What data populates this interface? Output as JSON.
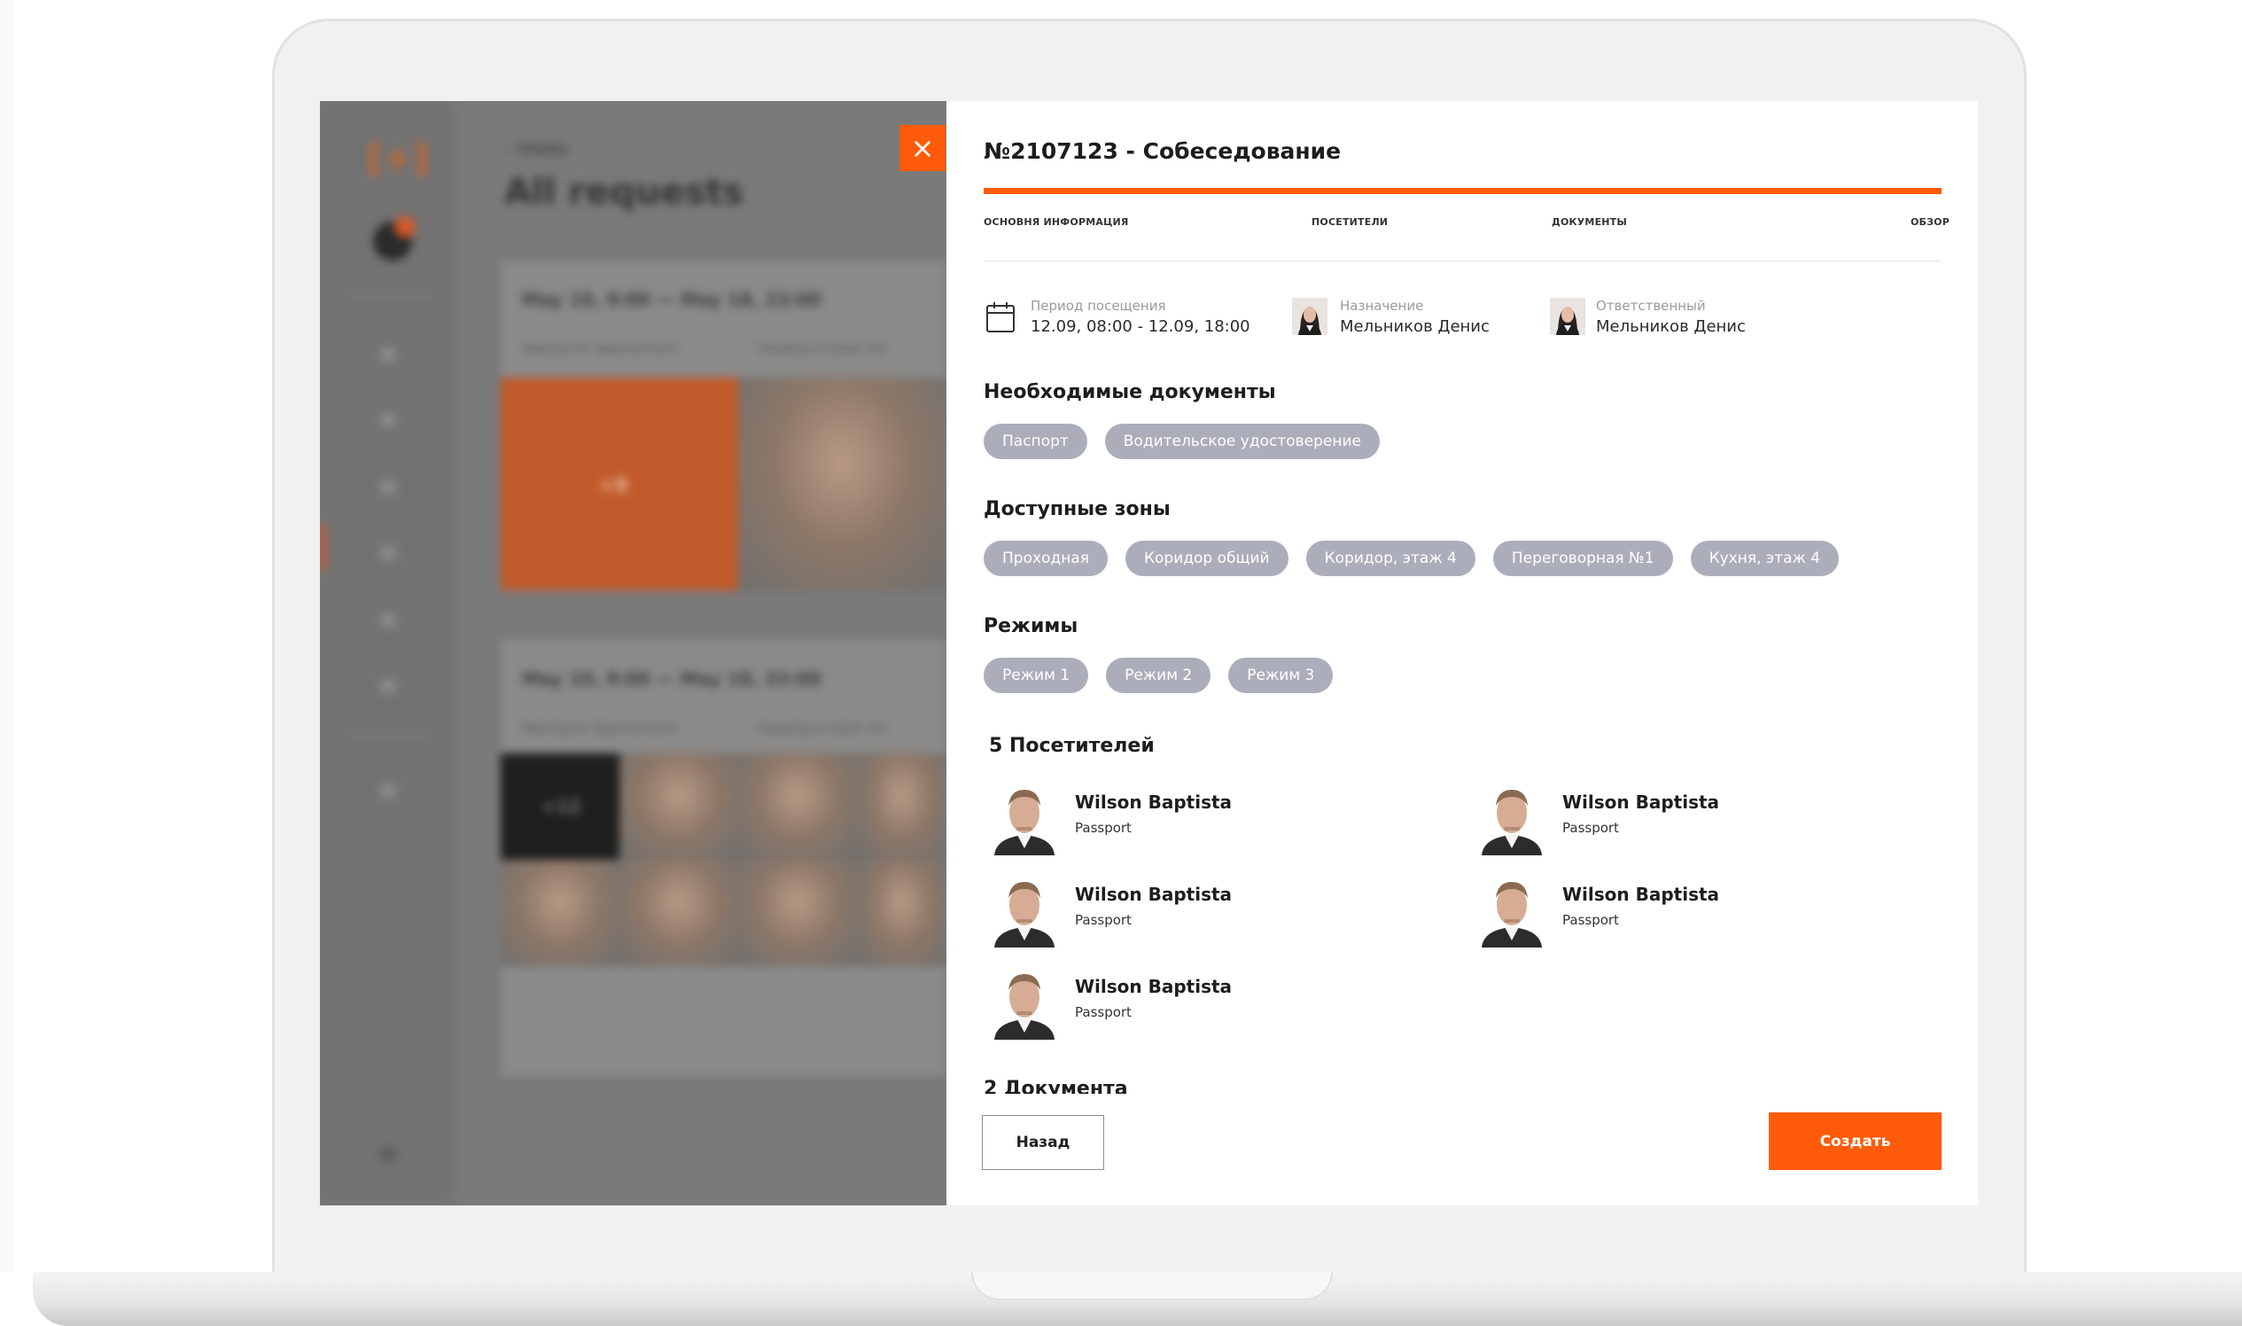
{
  "background_app": {
    "logo": "[+]",
    "breadcrumb": "‹ Visits",
    "heading": "All requests",
    "cards": [
      {
        "title": "May 10, 9:00 — May 18, 22:00",
        "status_1": "Waiting for Approvement",
        "status_2": "Heading to Stalin Str."
      },
      {
        "title": "May 10, 9:00 — May 18, 22:00",
        "status_1": "Waiting for Approvement",
        "status_2": "Heading to Stalin Str."
      }
    ],
    "orange_tile_label": "+9",
    "dark_tile_label": "+12"
  },
  "modal": {
    "close_glyph": "×",
    "title": "№2107123 - Собеседование",
    "steps": [
      "ОСНОВНЯ ИНФОРМАЦИЯ",
      "ПОСЕТИТЕЛИ",
      "ДОКУМЕНТЫ",
      "ОБЗОР"
    ],
    "progress_fraction": 1.0,
    "visit_period": {
      "label": "Период посещения",
      "value": "12.09, 08:00 - 12.09, 18:00",
      "icon": "calendar-icon"
    },
    "assignee": {
      "label": "Назначение",
      "value": "Мельников Денис"
    },
    "responsible": {
      "label": "Ответственный",
      "value": "Мельников Денис"
    },
    "required_documents": {
      "title": "Необходимые документы",
      "items": [
        "Паспорт",
        "Водительское удостоверение"
      ]
    },
    "zones": {
      "title": "Доступные зоны",
      "items": [
        "Проходная",
        "Коридор общий",
        "Коридор, этаж 4",
        "Переговорная №1",
        "Кухня, этаж 4"
      ]
    },
    "modes": {
      "title": "Режимы",
      "items": [
        "Режим 1",
        "Режим 2",
        "Режим 3"
      ]
    },
    "visitors": {
      "title": "5 Посетителей",
      "items": [
        {
          "name": "Wilson Baptista",
          "document": "Passport"
        },
        {
          "name": "Wilson Baptista",
          "document": "Passport"
        },
        {
          "name": "Wilson Baptista",
          "document": "Passport"
        },
        {
          "name": "Wilson Baptista",
          "document": "Passport"
        },
        {
          "name": "Wilson Baptista",
          "document": "Passport"
        }
      ]
    },
    "documents_title": "2 Документа",
    "back_label": "Назад",
    "create_label": "Создать"
  },
  "colors": {
    "accent": "#ff5b0a",
    "chip": "#abaeba"
  }
}
